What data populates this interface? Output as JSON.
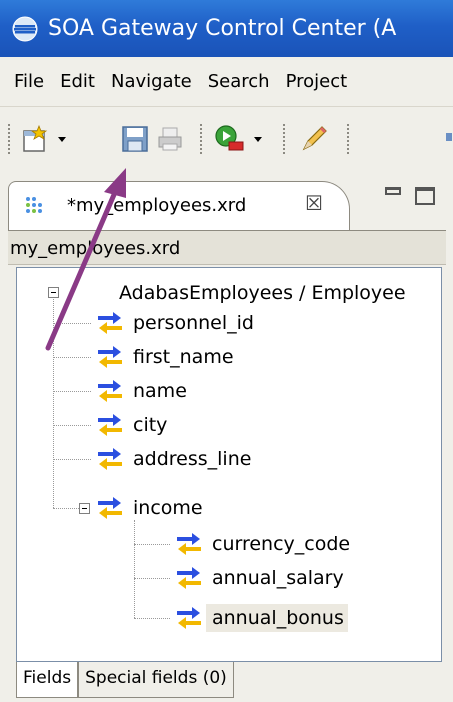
{
  "window": {
    "title": "SOA Gateway Control Center (A"
  },
  "menu": [
    "File",
    "Edit",
    "Navigate",
    "Search",
    "Project"
  ],
  "toolbar": {
    "icons": [
      "new-wizard-icon",
      "dropdown-icon",
      "save-icon",
      "print-icon",
      "run-icon",
      "dropdown-icon",
      "pencil-icon"
    ]
  },
  "editor": {
    "tab_label": "*my_employees.xrd",
    "close_glyph": "☒",
    "path_label": "my_employees.xrd",
    "tree": {
      "root": "AdabasEmployees / Employee",
      "fields": [
        "personnel_id",
        "first_name",
        "name",
        "city",
        "address_line"
      ],
      "group": "income",
      "group_fields": [
        "currency_code",
        "annual_salary",
        "annual_bonus"
      ]
    },
    "bottom_tabs": [
      "Fields",
      "Special fields (0)"
    ]
  },
  "colors": {
    "titlebar": "#1f5fc7",
    "arrow_blue": "#2b4fe0",
    "arrow_yellow": "#f2b800",
    "annotation_arrow": "#8a3a86"
  }
}
